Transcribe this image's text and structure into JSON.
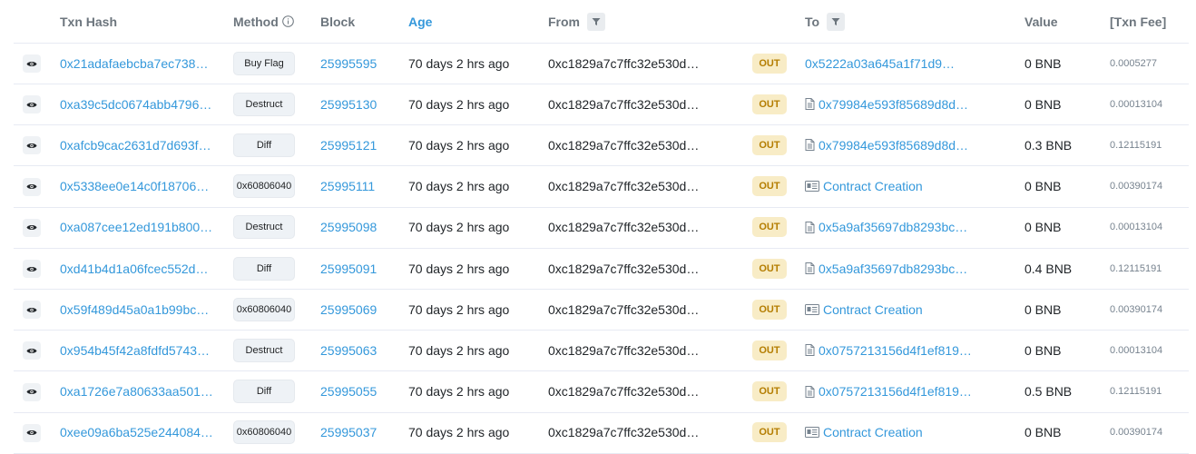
{
  "columns": {
    "txn_hash": "Txn Hash",
    "method": "Method",
    "block": "Block",
    "age": "Age",
    "from": "From",
    "to": "To",
    "value": "Value",
    "txn_fee": "[Txn Fee]"
  },
  "colors": {
    "link": "#3498db",
    "direction_bg": "#f8ecc6",
    "direction_text": "#b47d00",
    "method_bg": "#eef2f6"
  },
  "rows": [
    {
      "hash": "0x21adafaebcba7ec738…",
      "method": "Buy Flag",
      "block": "25995595",
      "age": "70 days 2 hrs ago",
      "from": "0xc1829a7c7ffc32e530d…",
      "direction": "OUT",
      "to": "0x5222a03a645a1f71d9…",
      "to_icon": "none",
      "value": "0 BNB",
      "fee": "0.0005277"
    },
    {
      "hash": "0xa39c5dc0674abb4796…",
      "method": "Destruct",
      "block": "25995130",
      "age": "70 days 2 hrs ago",
      "from": "0xc1829a7c7ffc32e530d…",
      "direction": "OUT",
      "to": "0x79984e593f85689d8d…",
      "to_icon": "contract",
      "value": "0 BNB",
      "fee": "0.00013104"
    },
    {
      "hash": "0xafcb9cac2631d7d693f…",
      "method": "Diff",
      "block": "25995121",
      "age": "70 days 2 hrs ago",
      "from": "0xc1829a7c7ffc32e530d…",
      "direction": "OUT",
      "to": "0x79984e593f85689d8d…",
      "to_icon": "contract",
      "value": "0.3 BNB",
      "fee": "0.12115191"
    },
    {
      "hash": "0x5338ee0e14c0f18706…",
      "method": "0x60806040",
      "block": "25995111",
      "age": "70 days 2 hrs ago",
      "from": "0xc1829a7c7ffc32e530d…",
      "direction": "OUT",
      "to": "Contract Creation",
      "to_icon": "creation",
      "value": "0 BNB",
      "fee": "0.00390174"
    },
    {
      "hash": "0xa087cee12ed191b800…",
      "method": "Destruct",
      "block": "25995098",
      "age": "70 days 2 hrs ago",
      "from": "0xc1829a7c7ffc32e530d…",
      "direction": "OUT",
      "to": "0x5a9af35697db8293bc…",
      "to_icon": "contract",
      "value": "0 BNB",
      "fee": "0.00013104"
    },
    {
      "hash": "0xd41b4d1a06fcec552d…",
      "method": "Diff",
      "block": "25995091",
      "age": "70 days 2 hrs ago",
      "from": "0xc1829a7c7ffc32e530d…",
      "direction": "OUT",
      "to": "0x5a9af35697db8293bc…",
      "to_icon": "contract",
      "value": "0.4 BNB",
      "fee": "0.12115191"
    },
    {
      "hash": "0x59f489d45a0a1b99bc…",
      "method": "0x60806040",
      "block": "25995069",
      "age": "70 days 2 hrs ago",
      "from": "0xc1829a7c7ffc32e530d…",
      "direction": "OUT",
      "to": "Contract Creation",
      "to_icon": "creation",
      "value": "0 BNB",
      "fee": "0.00390174"
    },
    {
      "hash": "0x954b45f42a8fdfd5743…",
      "method": "Destruct",
      "block": "25995063",
      "age": "70 days 2 hrs ago",
      "from": "0xc1829a7c7ffc32e530d…",
      "direction": "OUT",
      "to": "0x0757213156d4f1ef819…",
      "to_icon": "contract",
      "value": "0 BNB",
      "fee": "0.00013104"
    },
    {
      "hash": "0xa1726e7a80633aa501…",
      "method": "Diff",
      "block": "25995055",
      "age": "70 days 2 hrs ago",
      "from": "0xc1829a7c7ffc32e530d…",
      "direction": "OUT",
      "to": "0x0757213156d4f1ef819…",
      "to_icon": "contract",
      "value": "0.5 BNB",
      "fee": "0.12115191"
    },
    {
      "hash": "0xee09a6ba525e244084…",
      "method": "0x60806040",
      "block": "25995037",
      "age": "70 days 2 hrs ago",
      "from": "0xc1829a7c7ffc32e530d…",
      "direction": "OUT",
      "to": "Contract Creation",
      "to_icon": "creation",
      "value": "0 BNB",
      "fee": "0.00390174"
    }
  ]
}
